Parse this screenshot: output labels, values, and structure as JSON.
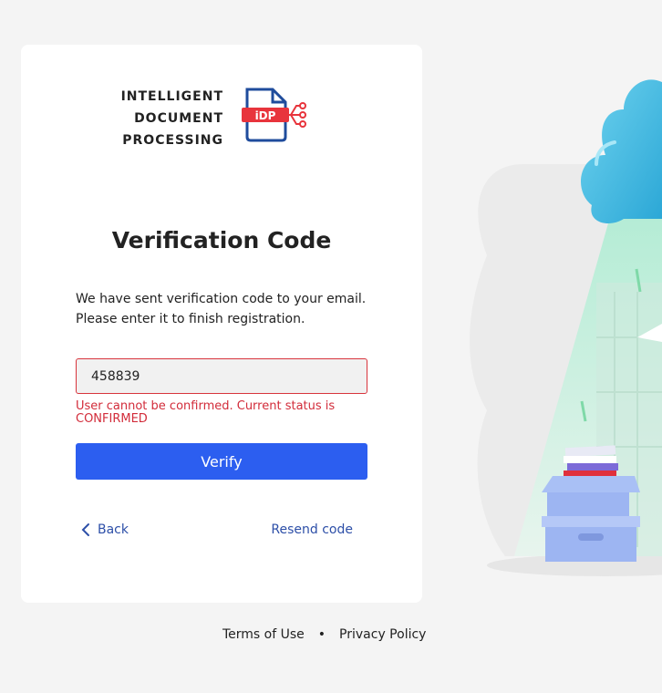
{
  "logo": {
    "lines": [
      "INTELLIGENT",
      "DOCUMENT",
      "PROCESSING"
    ],
    "icon_label": "iDP",
    "icon": "document-network-icon"
  },
  "page": {
    "title": "Verification Code",
    "description_line1": "We have sent verification code to your email.",
    "description_line2": "Please enter it to finish registration."
  },
  "form": {
    "code_value": "458839",
    "error_message": "User cannot be confirmed. Current status is CONFIRMED",
    "verify_label": "Verify",
    "back_label": "Back",
    "resend_label": "Resend code"
  },
  "footer": {
    "terms_label": "Terms of Use",
    "separator": "•",
    "privacy_label": "Privacy Policy"
  },
  "colors": {
    "accent": "#2c5ef0",
    "error": "#d22c3a",
    "link": "#2d4fa8",
    "logo_red": "#e8343c",
    "logo_blue": "#1f4c9c"
  }
}
